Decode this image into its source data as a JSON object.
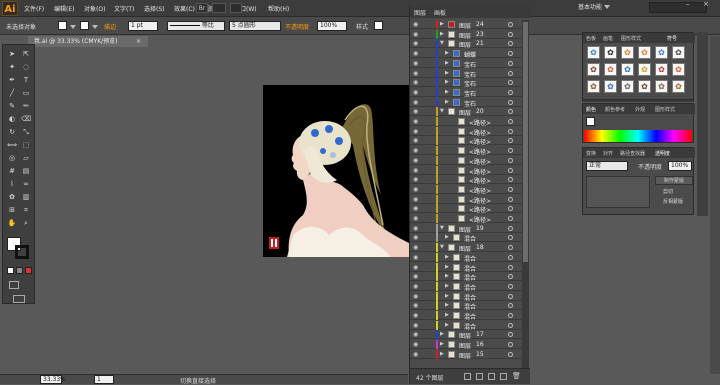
{
  "menubar": {
    "logo": "Ai",
    "items": [
      "文件(F)",
      "编辑(E)",
      "对象(O)",
      "文字(T)",
      "选择(S)",
      "效果(C)",
      "视图(V)",
      "窗口(W)",
      "帮助(H)"
    ],
    "workspace": "基本功能"
  },
  "control": {
    "selection": "未选择对象",
    "stroke_label": "描边",
    "stroke_value": "1 pt",
    "stroke_profile": "等比",
    "brush_value": "5 点圆形",
    "opacity_label": "不透明度",
    "opacity_value": "100%",
    "style_label": "样式"
  },
  "document": {
    "tab": "氛.ai @ 33.33% (CMYK/预览)",
    "close": "×"
  },
  "layers_panel": {
    "tabs": [
      "图层",
      "画板"
    ],
    "footer_count": "42 个图层",
    "rows": [
      {
        "name": "图层",
        "num": "24",
        "indent": 0,
        "color": "#d02020",
        "thumb": "red",
        "expanded": false
      },
      {
        "name": "图层",
        "num": "23",
        "indent": 0,
        "color": "#20a020",
        "thumb": "plain",
        "expanded": false
      },
      {
        "name": "图层",
        "num": "21",
        "indent": 0,
        "color": "#2040d0",
        "thumb": "plain",
        "expanded": true
      },
      {
        "name": "蝴蝶",
        "num": "",
        "indent": 1,
        "color": "#2040d0",
        "thumb": "blue",
        "expanded": false
      },
      {
        "name": "宝石",
        "num": "",
        "indent": 1,
        "color": "#2040d0",
        "thumb": "blue",
        "expanded": false
      },
      {
        "name": "宝石",
        "num": "",
        "indent": 1,
        "color": "#2040d0",
        "thumb": "blue",
        "expanded": false
      },
      {
        "name": "宝石",
        "num": "",
        "indent": 1,
        "color": "#2040d0",
        "thumb": "blue",
        "expanded": false
      },
      {
        "name": "宝石",
        "num": "",
        "indent": 1,
        "color": "#2040d0",
        "thumb": "blue",
        "expanded": false
      },
      {
        "name": "宝石",
        "num": "",
        "indent": 1,
        "color": "#2040d0",
        "thumb": "blue",
        "expanded": false
      },
      {
        "name": "图层",
        "num": "20",
        "indent": 0,
        "color": "#c8a020",
        "thumb": "plain",
        "expanded": true
      },
      {
        "name": "<路径>",
        "num": "",
        "indent": 2,
        "color": "#c8a020",
        "thumb": "plain",
        "expanded": false
      },
      {
        "name": "<路径>",
        "num": "",
        "indent": 2,
        "color": "#c8a020",
        "thumb": "plain",
        "expanded": false
      },
      {
        "name": "<路径>",
        "num": "",
        "indent": 2,
        "color": "#c8a020",
        "thumb": "plain",
        "expanded": false
      },
      {
        "name": "<路径>",
        "num": "",
        "indent": 2,
        "color": "#c8a020",
        "thumb": "plain",
        "expanded": false
      },
      {
        "name": "<路径>",
        "num": "",
        "indent": 2,
        "color": "#c8a020",
        "thumb": "plain",
        "expanded": false
      },
      {
        "name": "<路径>",
        "num": "",
        "indent": 2,
        "color": "#c8a020",
        "thumb": "plain",
        "expanded": false
      },
      {
        "name": "<路径>",
        "num": "",
        "indent": 2,
        "color": "#c8a020",
        "thumb": "plain",
        "expanded": false
      },
      {
        "name": "<路径>",
        "num": "",
        "indent": 2,
        "color": "#c8a020",
        "thumb": "plain",
        "expanded": false
      },
      {
        "name": "<路径>",
        "num": "",
        "indent": 2,
        "color": "#c8a020",
        "thumb": "plain",
        "expanded": false
      },
      {
        "name": "<路径>",
        "num": "",
        "indent": 2,
        "color": "#c8a020",
        "thumb": "plain",
        "expanded": false
      },
      {
        "name": "<路径>",
        "num": "",
        "indent": 2,
        "color": "#c8a020",
        "thumb": "plain",
        "expanded": false
      },
      {
        "name": "图层",
        "num": "19",
        "indent": 0,
        "color": "#a0a0a0",
        "thumb": "plain",
        "expanded": true
      },
      {
        "name": "混合",
        "num": "",
        "indent": 1,
        "color": "#a0a0a0",
        "thumb": "plain",
        "expanded": false
      },
      {
        "name": "图层",
        "num": "18",
        "indent": 0,
        "color": "#d0d020",
        "thumb": "plain",
        "expanded": true
      },
      {
        "name": "混合",
        "num": "",
        "indent": 1,
        "color": "#d0d020",
        "thumb": "plain",
        "expanded": false
      },
      {
        "name": "混合",
        "num": "",
        "indent": 1,
        "color": "#d0d020",
        "thumb": "plain",
        "expanded": false
      },
      {
        "name": "混合",
        "num": "",
        "indent": 1,
        "color": "#d0d020",
        "thumb": "plain",
        "expanded": false
      },
      {
        "name": "混合",
        "num": "",
        "indent": 1,
        "color": "#d0d020",
        "thumb": "plain",
        "expanded": false
      },
      {
        "name": "混合",
        "num": "",
        "indent": 1,
        "color": "#d0d020",
        "thumb": "plain",
        "expanded": false
      },
      {
        "name": "混合",
        "num": "",
        "indent": 1,
        "color": "#d0d020",
        "thumb": "plain",
        "expanded": false
      },
      {
        "name": "混合",
        "num": "",
        "indent": 1,
        "color": "#d0d020",
        "thumb": "plain",
        "expanded": false
      },
      {
        "name": "混合",
        "num": "",
        "indent": 1,
        "color": "#d0d020",
        "thumb": "plain",
        "expanded": false
      },
      {
        "name": "图层",
        "num": "17",
        "indent": 0,
        "color": "#2040d0",
        "thumb": "plain",
        "expanded": false
      },
      {
        "name": "图层",
        "num": "16",
        "indent": 0,
        "color": "#d030d0",
        "thumb": "plain",
        "expanded": false
      },
      {
        "name": "图层",
        "num": "15",
        "indent": 0,
        "color": "#d02020",
        "thumb": "plain",
        "expanded": false
      }
    ]
  },
  "symbols_panel": {
    "tabs": [
      "色板",
      "画笔",
      "图形样式",
      "符号"
    ],
    "symbols": [
      "#3a7ad0",
      "#222",
      "#e08030",
      "#e08030",
      "#3a7ad0",
      "#444",
      "#804020",
      "#c06030",
      "#3070c0",
      "#d0a020",
      "#c03030",
      "#e06020",
      "#905020",
      "#2a6ac0",
      "#606060",
      "#6a4020",
      "#806030",
      "#a06020"
    ]
  },
  "color_panel": {
    "tabs": [
      "颜色",
      "颜色参考",
      "外观",
      "图形样式"
    ]
  },
  "transparency_panel": {
    "tabs": [
      "变换",
      "对齐",
      "路径查找器",
      "透明度"
    ],
    "mode": "正常",
    "opacity_label": "不透明度",
    "opacity_value": "100%",
    "btn_mask": "制作蒙版",
    "chk_clip": "剪切",
    "chk_invert": "反相蒙版"
  },
  "statusbar": {
    "zoom": "33.33%",
    "page": "1",
    "tool": "切换直接选择"
  },
  "colors": {
    "accent": "#ff9a00",
    "panel_bg": "#4b4b4b"
  }
}
